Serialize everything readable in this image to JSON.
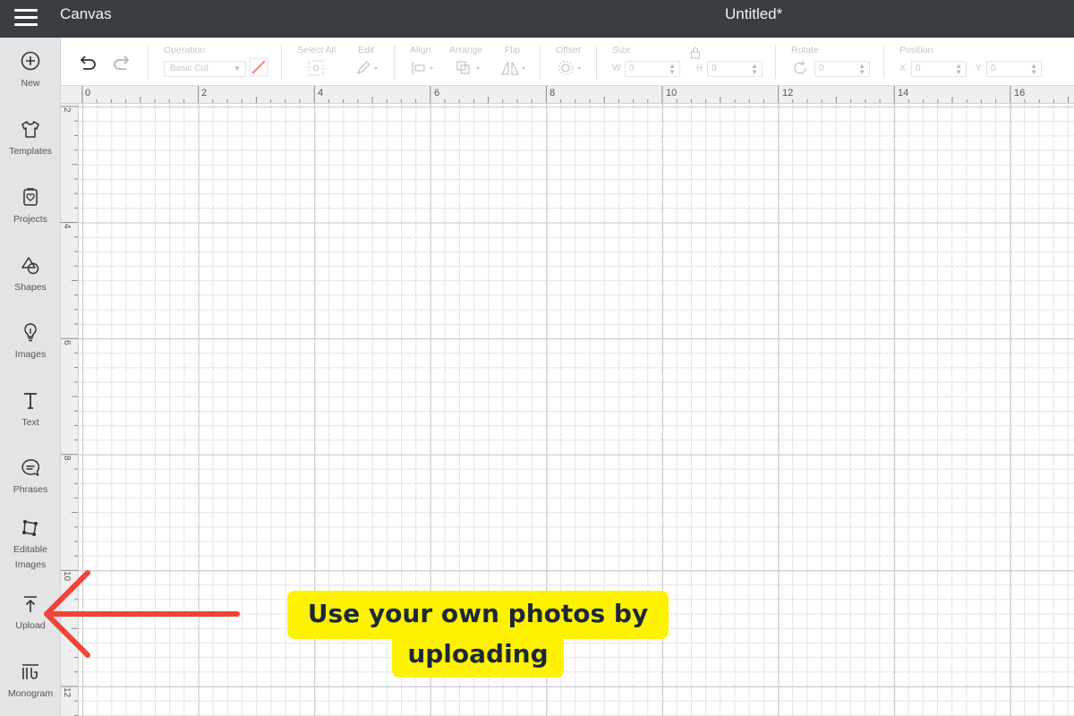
{
  "topbar": {
    "app_title": "Canvas",
    "doc_title": "Untitled*"
  },
  "sidebar": {
    "items": [
      {
        "label": "New",
        "icon": "plus-circle-icon"
      },
      {
        "label": "Templates",
        "icon": "tshirt-icon"
      },
      {
        "label": "Projects",
        "icon": "projects-icon"
      },
      {
        "label": "Shapes",
        "icon": "shapes-icon"
      },
      {
        "label": "Images",
        "icon": "lightbulb-icon"
      },
      {
        "label": "Text",
        "icon": "text-icon"
      },
      {
        "label": "Phrases",
        "icon": "speech-bubble-icon"
      },
      {
        "label": "Editable Images",
        "icon": "editable-image-icon"
      },
      {
        "label": "Upload",
        "icon": "upload-icon"
      },
      {
        "label": "Monogram",
        "icon": "monogram-icon"
      }
    ]
  },
  "toolbar": {
    "operation_label": "Operation",
    "operation_value": "Basic Cut",
    "select_all_label": "Select All",
    "edit_label": "Edit",
    "align_label": "Align",
    "arrange_label": "Arrange",
    "flip_label": "Flip",
    "offset_label": "Offset",
    "size_label": "Size",
    "size_w_prefix": "W",
    "size_h_prefix": "H",
    "size_w_value": "0",
    "size_h_value": "0",
    "rotate_label": "Rotate",
    "rotate_value": "0",
    "position_label": "Position",
    "position_x_prefix": "X",
    "position_y_prefix": "Y",
    "position_x_value": "0",
    "position_y_value": "0"
  },
  "rulers": {
    "horizontal": [
      "0",
      "2",
      "4",
      "6",
      "8",
      "10",
      "12",
      "14",
      "16"
    ],
    "vertical": [
      "2",
      "4",
      "6",
      "8",
      "10",
      "12"
    ]
  },
  "annotation": {
    "line1": "Use your own photos by",
    "line2": "uploading",
    "color": "#fff200",
    "arrow_color": "#f04438"
  }
}
